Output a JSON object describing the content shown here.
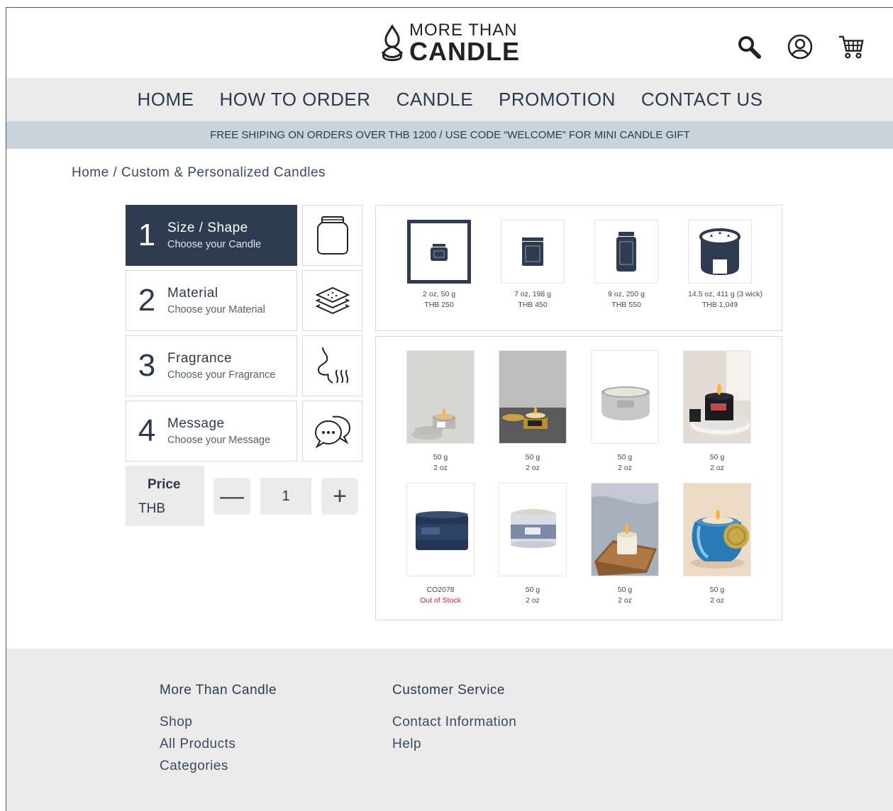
{
  "brand": {
    "line1": "MORE THAN",
    "line2": "CANDLE"
  },
  "header_icons": [
    "search-icon",
    "account-icon",
    "cart-icon"
  ],
  "nav": [
    "HOME",
    "HOW TO ORDER",
    "CANDLE",
    "PROMOTION",
    "CONTACT US"
  ],
  "promo": "FREE SHIPING ON ORDERS OVER THB 1200 / USE CODE “WELCOME” FOR MINI CANDLE GIFT",
  "breadcrumb": {
    "home": "Home",
    "sep": " / ",
    "current": "Custom & Personalized Candles"
  },
  "steps": [
    {
      "num": "1",
      "title": "Size / Shape",
      "sub": "Choose your Candle",
      "icon": "jar-icon",
      "active": true
    },
    {
      "num": "2",
      "title": "Material",
      "sub": "Choose your Material",
      "icon": "layers-icon",
      "active": false
    },
    {
      "num": "3",
      "title": "Fragrance",
      "sub": "Choose your Fragrance",
      "icon": "scent-icon",
      "active": false
    },
    {
      "num": "4",
      "title": "Message",
      "sub": "Choose your Message",
      "icon": "message-icon",
      "active": false
    }
  ],
  "price": {
    "label": "Price",
    "currency": "THB"
  },
  "quantity": {
    "minus": "—",
    "value": "1",
    "plus": "+"
  },
  "sizes": [
    {
      "t1": "2 oz, 50 g",
      "t2": "THB 250",
      "selected": true
    },
    {
      "t1": "7 oz, 198 g",
      "t2": "THB 450",
      "selected": false
    },
    {
      "t1": "9 oz, 250 g",
      "t2": "THB 550",
      "selected": false
    },
    {
      "t1": "14.5 oz, 411 g (3 wick)",
      "t2": "THB 1,049",
      "selected": false
    }
  ],
  "products": [
    {
      "t1": "50 g",
      "t2": "2 oz"
    },
    {
      "t1": "50 g",
      "t2": "2 oz"
    },
    {
      "t1": "50 g",
      "t2": "2 oz"
    },
    {
      "t1": "50 g",
      "t2": "2 oz"
    },
    {
      "t1": "CO2078",
      "t2": "Out of Stock",
      "out_of_stock": true
    },
    {
      "t1": "50 g",
      "t2": "2 oz"
    },
    {
      "t1": "50 g",
      "t2": "2 oz"
    },
    {
      "t1": "50 g",
      "t2": "2 oz"
    }
  ],
  "footer": {
    "col1": {
      "heading": "More Than Candle",
      "links": [
        "Shop",
        "All Products",
        "Categories"
      ]
    },
    "col2": {
      "heading": "Customer Service",
      "links": [
        "Contact Information",
        "Help"
      ]
    }
  },
  "colors": {
    "navy": "#2e3b50",
    "nav_bg": "#ebebeb",
    "promo_bg": "#c9d3dc",
    "out_of_stock": "#d42a2a"
  }
}
